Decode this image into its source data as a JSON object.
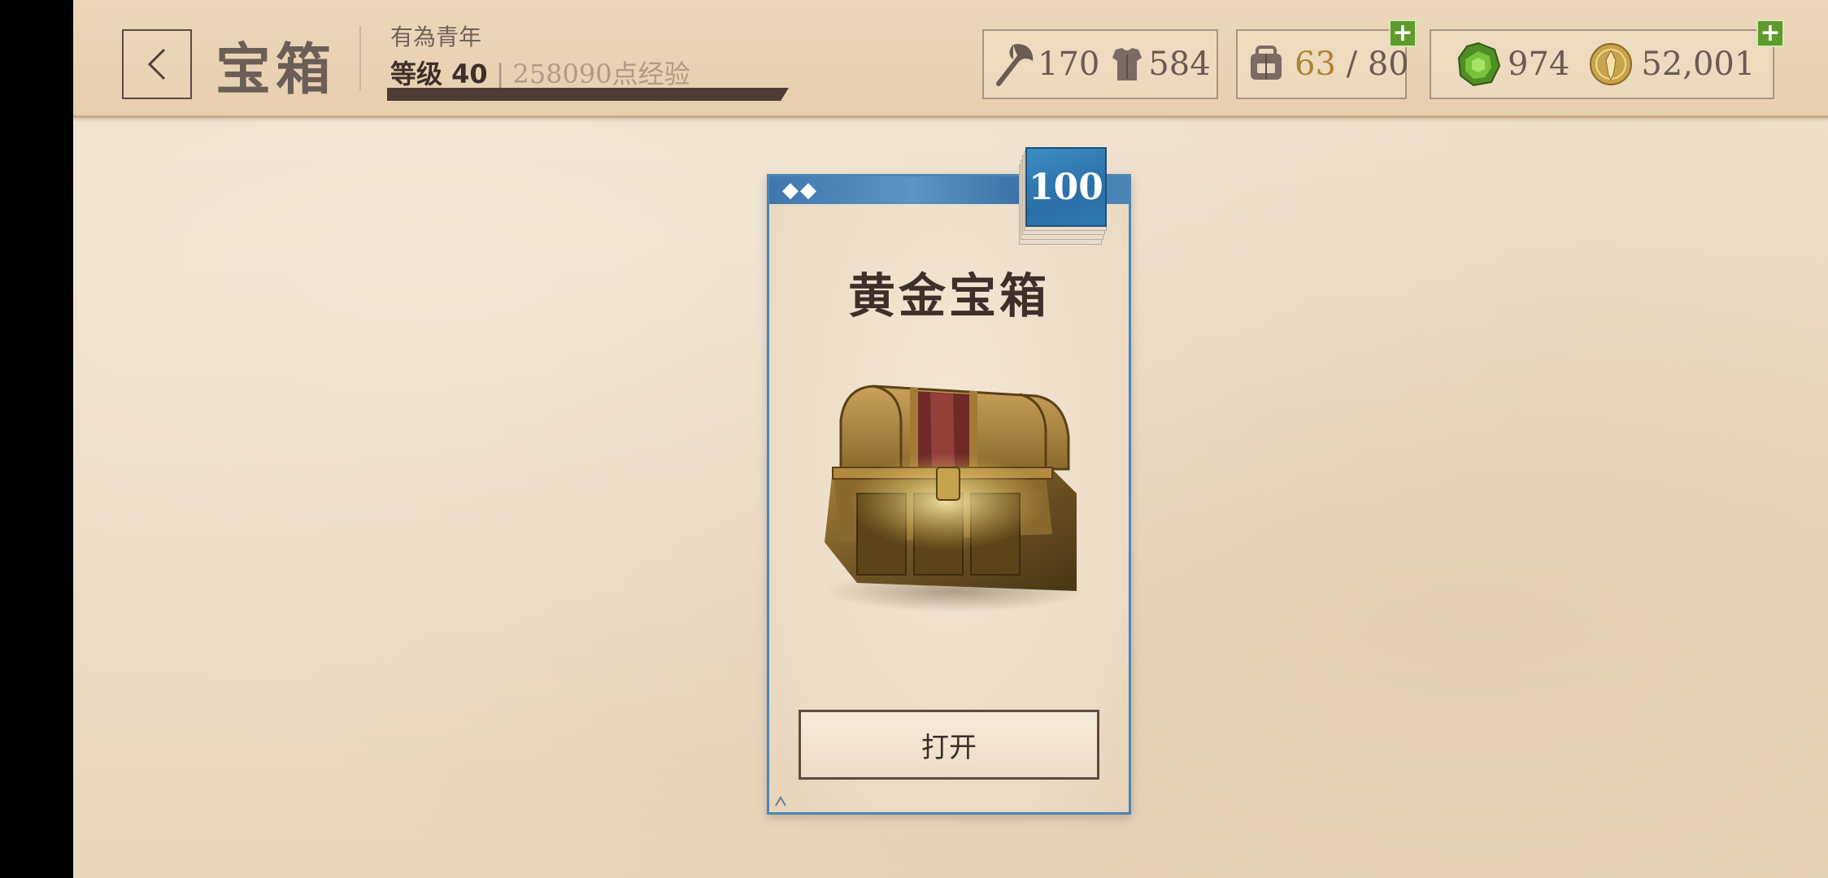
{
  "header": {
    "title": "宝箱",
    "player_title": "有為青年",
    "level_label": "等级 40",
    "xp_label": "258090点经验",
    "xp_progress": 1.0
  },
  "stats": {
    "attack": "170",
    "armor": "584",
    "inventory_current": "63",
    "inventory_separator": " / ",
    "inventory_max": "80",
    "gems": "974",
    "gold": "52,001"
  },
  "card": {
    "rarity_marks": "◆◆",
    "count": "100",
    "name": "黄金宝箱",
    "open_label": "打开"
  },
  "colors": {
    "parchment": "#ecdcc5",
    "accent_blue": "#3f77ad",
    "add_green": "#5f9a2c",
    "inventory_gold": "#b0822e"
  },
  "icons": {
    "back": "chevron-left-icon",
    "attack": "axe-icon",
    "armor": "armor-icon",
    "inventory": "backpack-icon",
    "gems": "gem-icon",
    "gold": "gold-coin-icon",
    "add": "plus-icon"
  }
}
